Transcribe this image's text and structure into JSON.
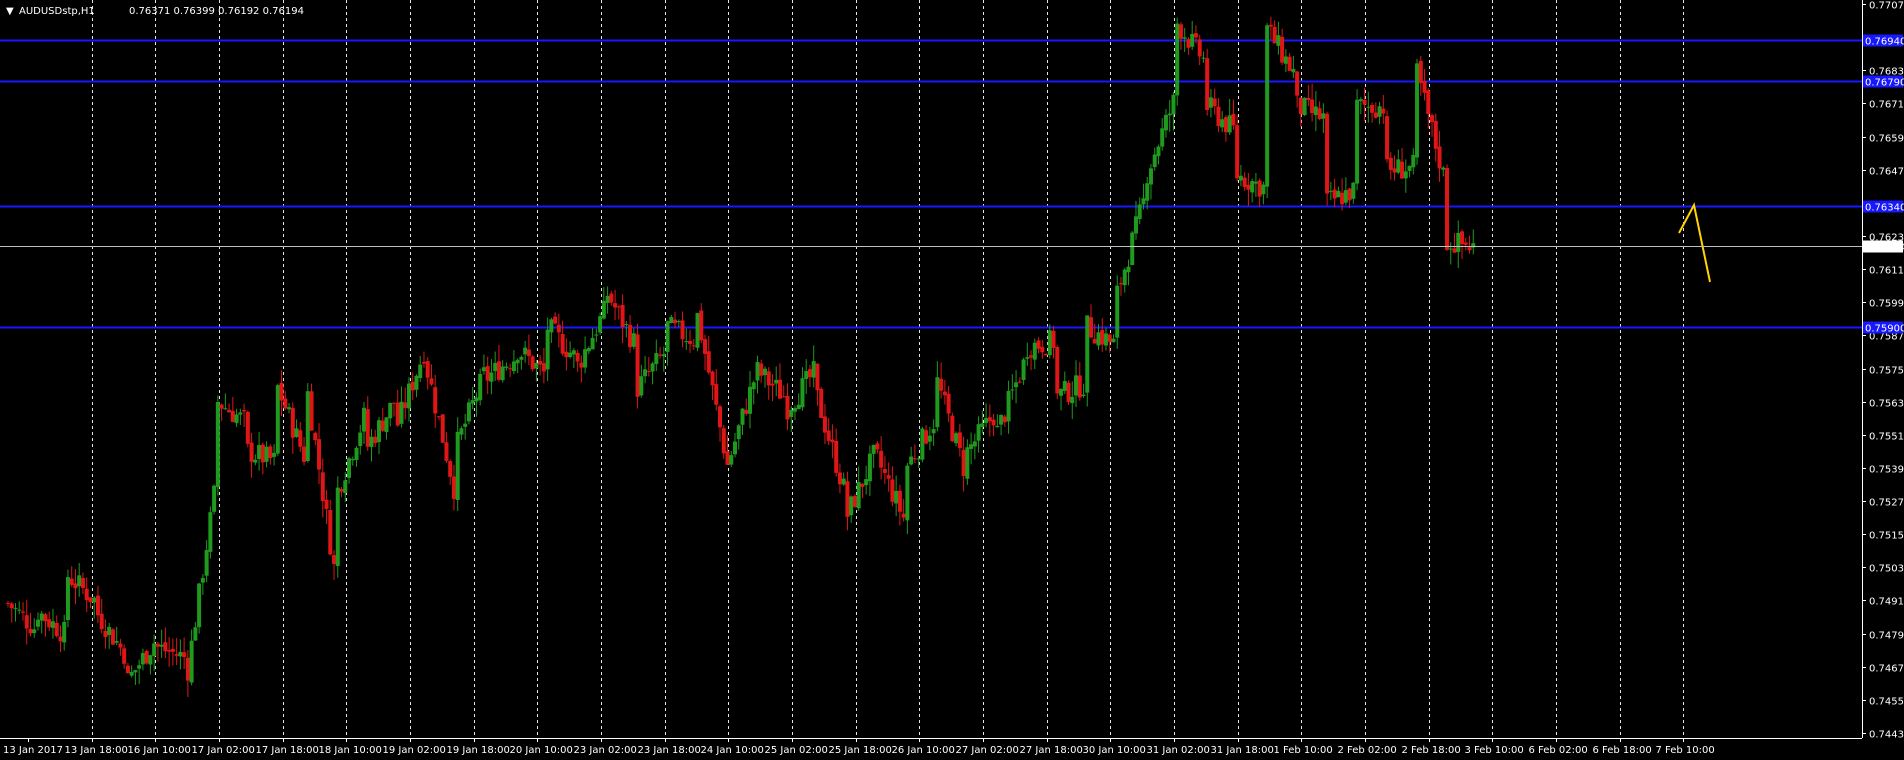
{
  "header": {
    "menu_glyph": "▼",
    "symbol_tf": "AUDUSDstp,H1",
    "ohlc": "0.76371 0.76399 0.76192 0.76194"
  },
  "colors": {
    "background": "#000000",
    "bull": "#1f9a1f",
    "bear": "#e01616",
    "grid": "#ffffff",
    "hline": "#1818ff",
    "arrow": "#ffd400",
    "axis_text": "#ffffff"
  },
  "chart_data": {
    "type": "candlestick",
    "symbol": "AUDUSDstp",
    "timeframe": "H1",
    "ylim": [
      0.7443,
      0.7707
    ],
    "y_ticks": [
      "0.77070",
      "0.76950",
      "0.76830",
      "0.76710",
      "0.76590",
      "0.76470",
      "0.76350",
      "0.76230",
      "0.76110",
      "0.75990",
      "0.75870",
      "0.75750",
      "0.75630",
      "0.75510",
      "0.75390",
      "0.75270",
      "0.75150",
      "0.75030",
      "0.74910",
      "0.74790",
      "0.74670",
      "0.74550",
      "0.74430"
    ],
    "x_ticks": [
      "13 Jan 2017",
      "13 Jan 18:00",
      "16 Jan 10:00",
      "17 Jan 02:00",
      "17 Jan 18:00",
      "18 Jan 10:00",
      "19 Jan 02:00",
      "19 Jan 18:00",
      "20 Jan 10:00",
      "23 Jan 02:00",
      "23 Jan 18:00",
      "24 Jan 10:00",
      "25 Jan 02:00",
      "25 Jan 18:00",
      "26 Jan 10:00",
      "27 Jan 02:00",
      "27 Jan 18:00",
      "30 Jan 10:00",
      "31 Jan 02:00",
      "31 Jan 18:00",
      "1 Feb 10:00",
      "2 Feb 02:00",
      "2 Feb 18:00",
      "3 Feb 10:00",
      "6 Feb 02:00",
      "6 Feb 18:00",
      "7 Feb 10:00"
    ],
    "horizontal_lines": [
      {
        "price": 0.7694,
        "label": "0.76940"
      },
      {
        "price": 0.7679,
        "label": "0.76790"
      },
      {
        "price": 0.7634,
        "label": "0.76340"
      },
      {
        "price": 0.759,
        "label": "0.75900"
      }
    ],
    "current_price": {
      "value": 0.76194,
      "label": "0.76194"
    },
    "projection_arrow": {
      "path": [
        [
          0.7625,
          0.7635
        ],
        [
          0.7622,
          0.7608
        ]
      ]
    },
    "waypoints": [
      [
        0.749,
        0.748
      ],
      [
        0.7487,
        0.7478
      ],
      [
        0.75,
        0.749
      ],
      [
        0.7486,
        0.747
      ],
      [
        0.7462,
        0.7478
      ],
      [
        0.7474,
        0.747
      ],
      [
        0.7466,
        0.7538
      ],
      [
        0.7563,
        0.7555
      ],
      [
        0.7545,
        0.7541
      ],
      [
        0.7568,
        0.754
      ],
      [
        0.7566,
        0.7494
      ],
      [
        0.7531,
        0.7561
      ],
      [
        0.7547,
        0.7565
      ],
      [
        0.7555,
        0.7585
      ],
      [
        0.7574,
        0.7526
      ],
      [
        0.7548,
        0.7576
      ],
      [
        0.7572,
        0.758
      ],
      [
        0.7582,
        0.7572
      ],
      [
        0.759,
        0.7578
      ],
      [
        0.7576,
        0.7598
      ],
      [
        0.7602,
        0.7582
      ],
      [
        0.7568,
        0.7582
      ],
      [
        0.759,
        0.7585
      ],
      [
        0.7594,
        0.754
      ],
      [
        0.754,
        0.7575
      ],
      [
        0.7574,
        0.7564
      ],
      [
        0.7561,
        0.7575
      ],
      [
        0.7564,
        0.7527
      ],
      [
        0.7522,
        0.7546
      ],
      [
        0.7542,
        0.7518
      ],
      [
        0.754,
        0.7558
      ],
      [
        0.757,
        0.7535
      ],
      [
        0.7545,
        0.756
      ],
      [
        0.7552,
        0.758
      ],
      [
        0.7583,
        0.7585
      ],
      [
        0.7565,
        0.757
      ],
      [
        0.759,
        0.7583
      ],
      [
        0.7602,
        0.764
      ],
      [
        0.7646,
        0.7675
      ],
      [
        0.77,
        0.7685
      ],
      [
        0.767,
        0.766
      ],
      [
        0.7645,
        0.764
      ],
      [
        0.7698,
        0.768
      ],
      [
        0.767,
        0.7665
      ],
      [
        0.7635,
        0.764
      ],
      [
        0.767,
        0.767
      ],
      [
        0.7647,
        0.7648
      ],
      [
        0.7682,
        0.764
      ],
      [
        0.7621,
        0.7619
      ]
    ]
  }
}
